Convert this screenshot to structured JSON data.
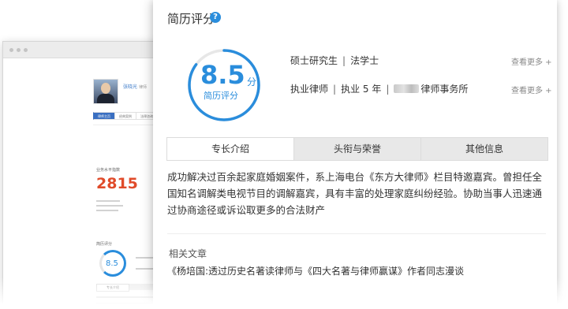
{
  "background_window": {
    "lawyer_name": "张晓光",
    "lawyer_title": "律师",
    "tabs": [
      "律师主页",
      "经典案例",
      "法律咨询"
    ],
    "level_label": "业务水平指数",
    "level_value": "2815",
    "score_label": "简历评分",
    "score_value": "8.5",
    "tab_active": "专长介绍"
  },
  "card": {
    "title": "简历评分",
    "help_icon": "question-circle-icon",
    "score": {
      "value": "8.5",
      "unit": "分",
      "label": "简历评分",
      "max": 10
    },
    "education": {
      "degree": "硕士研究生",
      "major": "法学士"
    },
    "career": {
      "status": "执业律师",
      "years": "执业 5 年",
      "firm_suffix": "律师事务所"
    },
    "more_link": "查看更多 +",
    "tabs": [
      "专长介绍",
      "头衔与荣誉",
      "其他信息"
    ],
    "active_tab": 0,
    "description": "成功解决过百余起家庭婚姻案件，系上海电台《东方大律师》栏目特邀嘉宾。曾担任全国知名调解类电视节目的调解嘉宾，具有丰富的处理家庭纠纷经验。协助当事人迅速通过协商途径或诉讼取更多的合法财产",
    "related_title": "相关文章",
    "articles": [
      "《杨培国:透过历史名著读律师与《四大名著与律师赢谋》作者同志漫谈"
    ]
  },
  "colors": {
    "accent": "#2a8ddc",
    "level_red": "#e04b2a",
    "tab_bg": "#e8e8e8"
  }
}
